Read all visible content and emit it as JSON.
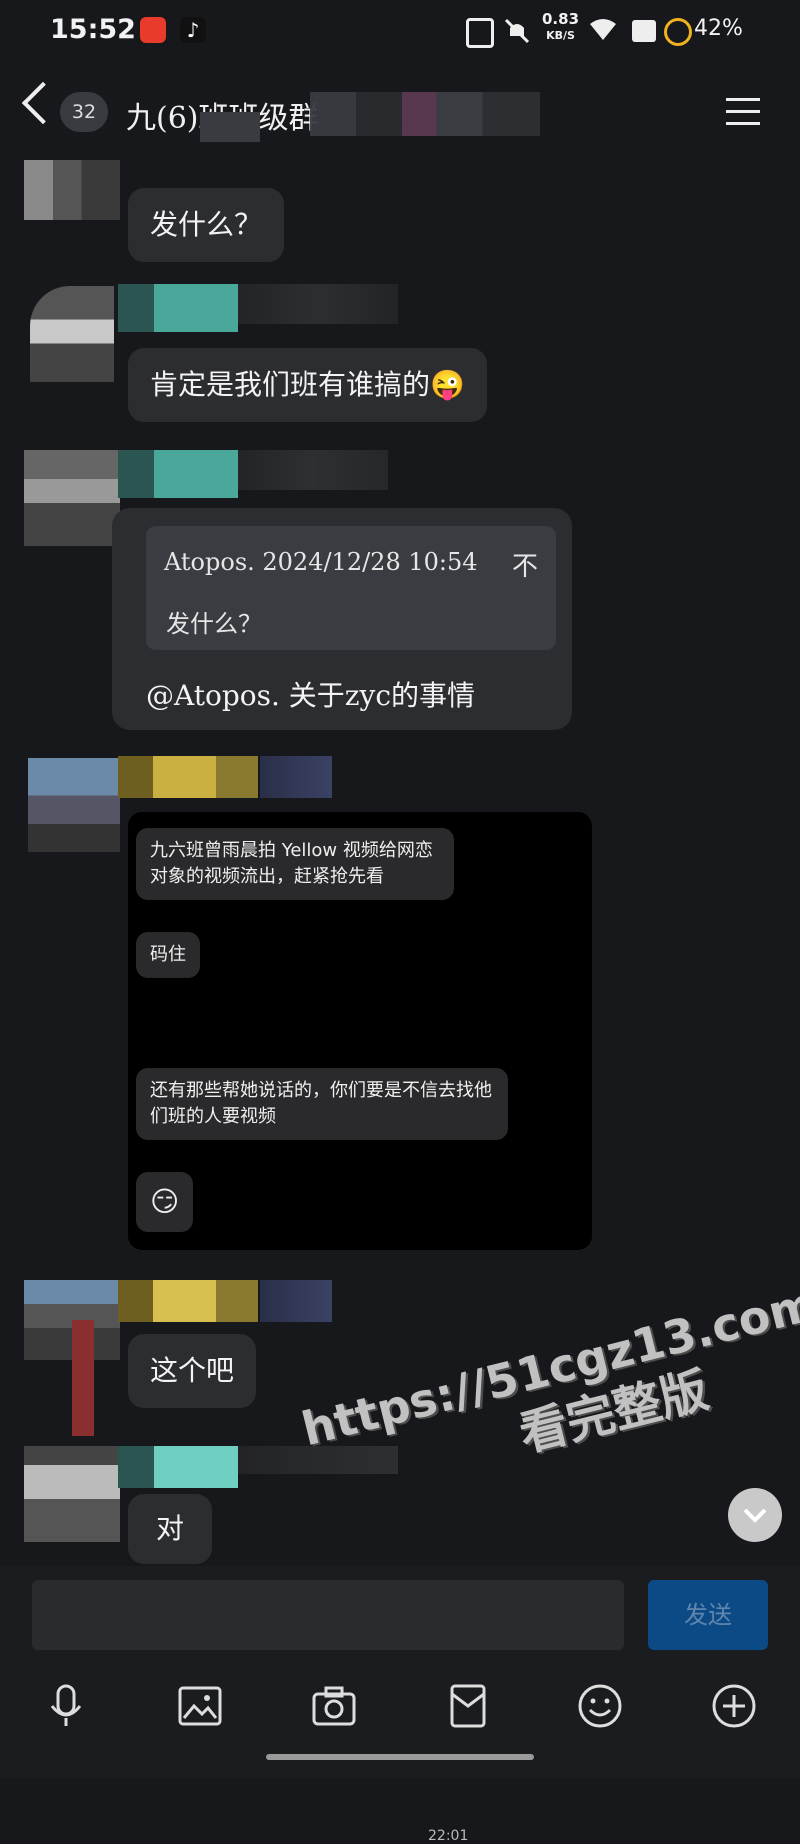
{
  "status_bar": {
    "time": "15:52",
    "network_speed": "0.83",
    "network_unit": "KB/S",
    "battery": "42%"
  },
  "header": {
    "unread_count": "32",
    "title": "九(6)班班级群"
  },
  "messages": [
    {
      "text": "发什么？"
    },
    {
      "text": "肯定是我们班有谁搞的",
      "emoji": "😜"
    },
    {
      "quote_author": "Atopos. 2024/12/28 10:54",
      "quote_close": "不",
      "quote_text": "发什么？",
      "reply": "@Atopos. 关于zyc的事情"
    },
    {
      "image": {
        "msg1": "九六班曾雨晨拍 Yellow 视频给网恋对象的视频流出，赶紧抢先看",
        "msg2": "码住",
        "time": "22:01",
        "msg3": "还有那些帮她说话的，你们要是不信去找他们班的人要视频",
        "msg4_emoji": "😏"
      }
    },
    {
      "text": "这个吧"
    },
    {
      "text": "对"
    }
  ],
  "input": {
    "placeholder": "",
    "send_label": "发送"
  },
  "toolbar": [
    "mic-icon",
    "image-icon",
    "camera-icon",
    "red-packet-icon",
    "emoji-icon",
    "plus-icon"
  ],
  "watermark": {
    "line1": "https://51cgz13.com",
    "line2": "看完整版"
  },
  "colors": {
    "background": "#17181b",
    "bubble": "#2c2d31",
    "send": "#0c4a86"
  }
}
